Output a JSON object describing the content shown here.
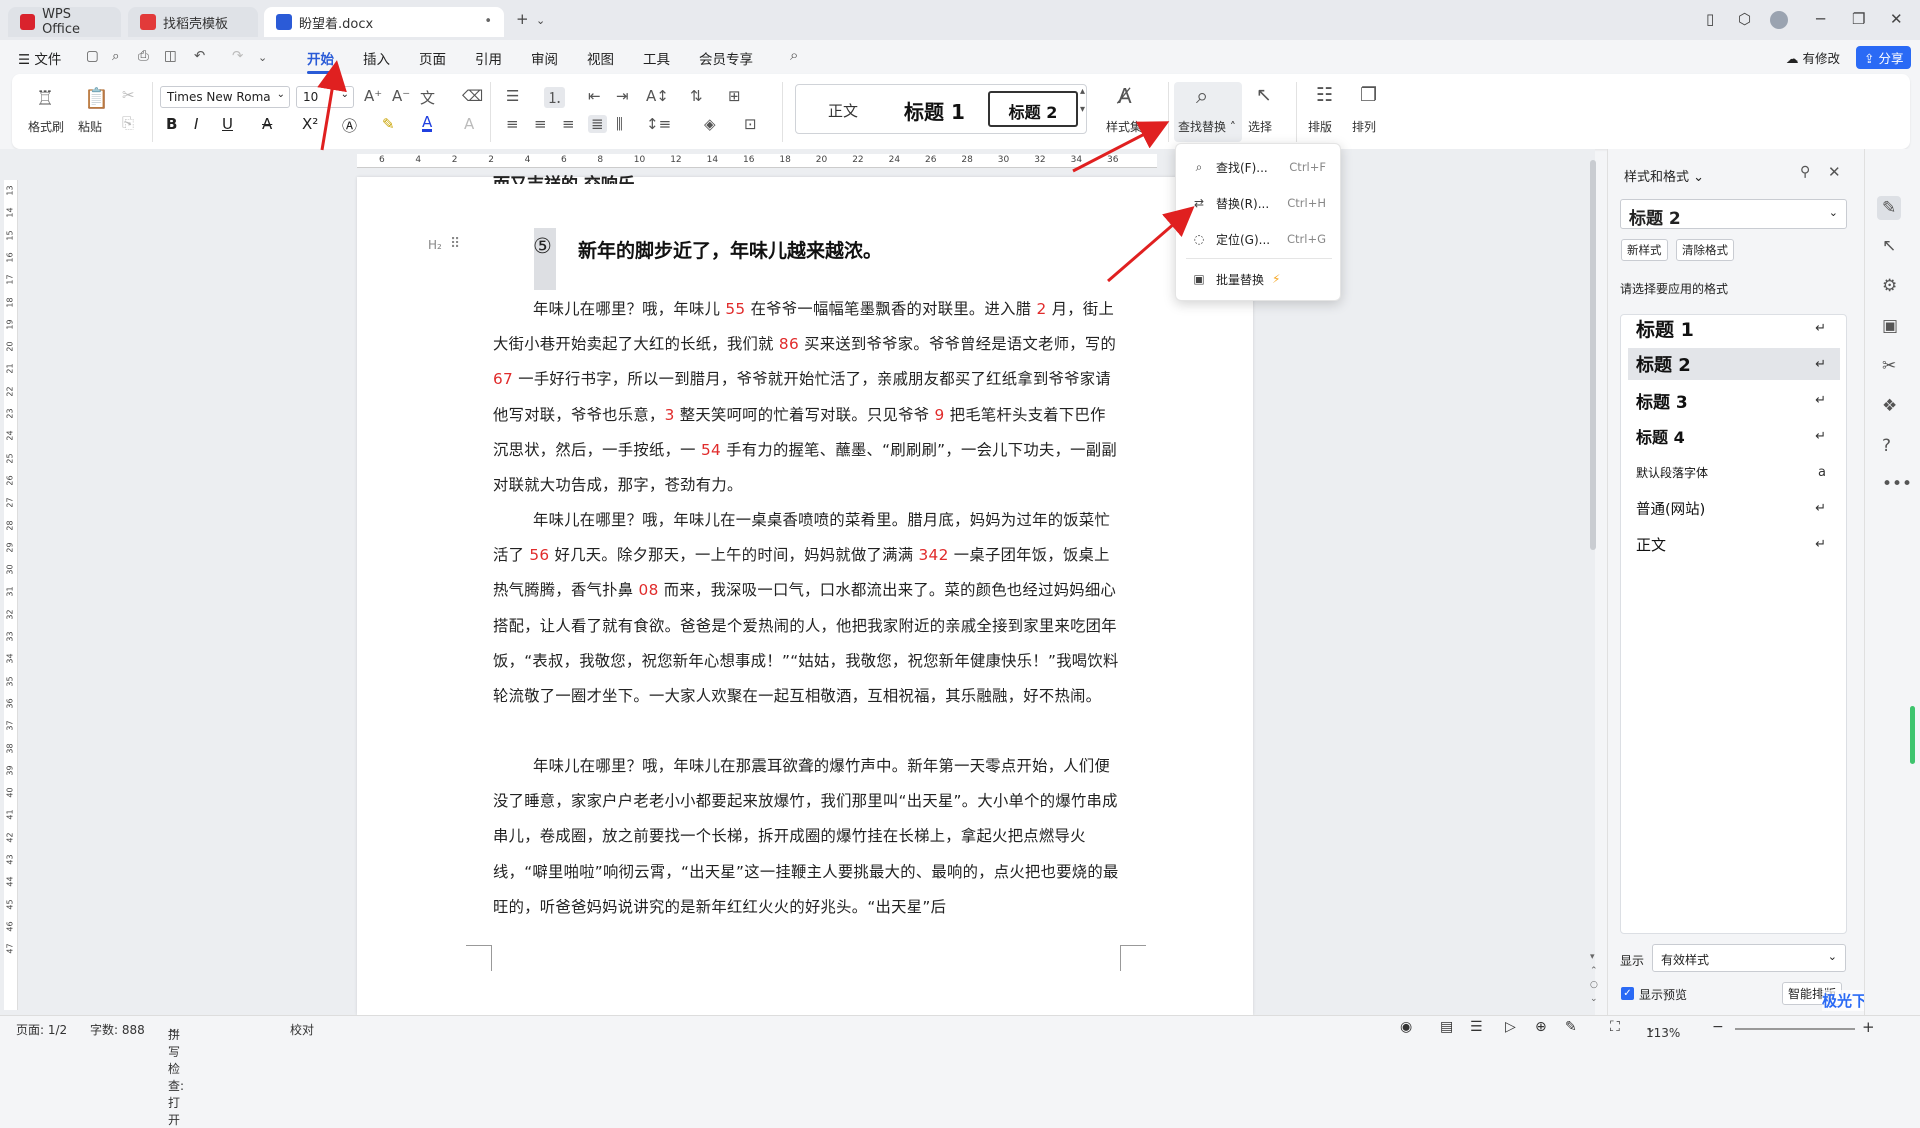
{
  "tabs": [
    {
      "label": "WPS Office",
      "color": "#d9232d"
    },
    {
      "label": "找稻壳模板",
      "color": "#e23a3a"
    },
    {
      "label": "盼望着.docx",
      "color": "#2b5bd7",
      "close": "•"
    }
  ],
  "menu": {
    "file": "文件",
    "items": [
      "开始",
      "插入",
      "页面",
      "引用",
      "审阅",
      "视图",
      "工具",
      "会员专享"
    ],
    "active": "开始",
    "modified": "有修改",
    "share": "分享"
  },
  "ribbon": {
    "format_brush": "格式刷",
    "paste": "粘贴",
    "font_name": "Times New Roma",
    "font_size": "10",
    "styles": {
      "normal": "正文",
      "h1": "标题 1",
      "h2": "标题 2"
    },
    "style_set": "样式集",
    "find_replace": "查找替换",
    "select": "选择",
    "layout": "排版",
    "arrange": "排列"
  },
  "ruler": {
    "h": [
      "6",
      "4",
      "2",
      "2",
      "4",
      "6",
      "8",
      "10",
      "12",
      "14",
      "16",
      "18",
      "20",
      "22",
      "24",
      "26",
      "28",
      "30",
      "32",
      "34",
      "36"
    ],
    "v": [
      "13",
      "14",
      "15",
      "16",
      "17",
      "18",
      "19",
      "20",
      "21",
      "22",
      "23",
      "24",
      "25",
      "26",
      "27",
      "28",
      "29",
      "30",
      "31",
      "32",
      "33",
      "34",
      "35",
      "36",
      "37",
      "38",
      "39",
      "40",
      "41",
      "42",
      "43",
      "44",
      "45",
      "46",
      "47"
    ]
  },
  "doc": {
    "cut_heading": "而又吉祥的 交响乐。",
    "heading_label": "H₂",
    "heading_num": "⑤",
    "heading": "新年的脚步近了，年味儿越来越浓。",
    "p1": [
      "年味儿在哪里？哦，年味儿 ",
      "55",
      " 在爷爷一幅幅笔墨飘香的对联里。进入腊 ",
      "2",
      " 月，街上大街小巷开始卖起了大红的长纸，我们就 ",
      "86",
      " 买来送到爷爷家。爷爷曾经是语文老师，写的 ",
      "67",
      " 一手好行书字，所以一到腊月，爷爷就开始忙活了，亲戚朋友都买了红纸拿到爷爷家请他写对联，爷爷也乐意，",
      "3",
      " 整天笑呵呵的忙着写对联。只见爷爷 ",
      "9",
      " 把毛笔杆头支着下巴作沉思状，然后，一手按纸，一 ",
      "54",
      " 手有力的握笔、蘸墨、“刷刷刷”，一会儿下功夫，一副副对联就大功告成，那字，苍劲有力。"
    ],
    "p2": [
      "年味儿在哪里？哦，年味儿在一桌桌香喷喷的菜肴里。腊月底，妈妈为过年的饭菜忙活了 ",
      "56",
      " 好几天。除夕那天，一上午的时间，妈妈就做了满满 ",
      "342",
      " 一桌子团年饭，饭桌上热气腾腾，香气扑鼻 ",
      "08",
      " 而来，我深吸一口气，口水都流出来了。菜的颜色也经过妈妈细心搭配，让人看了就有食欲。爸爸是个爱热闹的人，他把我家附近的亲戚全接到家里来吃团年饭，“表叔，我敬您，祝您新年心想事成！”“姑姑，我敬您，祝您新年健康快乐！”我喝饮料轮流敬了一圈才坐下。一大家人欢聚在一起互相敬酒，互相祝福，其乐融融，好不热闹。"
    ],
    "p3": "年味儿在哪里？哦，年味儿在那震耳欲聋的爆竹声中。新年第一天零点开始，人们便没了睡意，家家户户老老小小都要起来放爆竹，我们那里叫“出天星”。大小单个的爆竹串成串儿，卷成圈，放之前要找一个长梯，拆开成圈的爆竹挂在长梯上，拿起火把点燃导火线，“噼里啪啦”响彻云霄，“出天星”这一挂鞭主人要挑最大的、最响的，点火把也要烧的最旺的，听爸爸妈妈说讲究的是新年红红火火的好兆头。“出天星”后"
  },
  "find_menu": [
    {
      "label": "查找(F)...",
      "shortcut": "Ctrl+F",
      "icon": "search-icon"
    },
    {
      "label": "替换(R)...",
      "shortcut": "Ctrl+H",
      "icon": "replace-icon"
    },
    {
      "label": "定位(G)...",
      "shortcut": "Ctrl+G",
      "icon": "locate-icon"
    },
    {
      "label": "批量替换",
      "shortcut": "",
      "icon": "batch-replace-icon"
    }
  ],
  "panel": {
    "title": "样式和格式",
    "current": "标题 2",
    "new_style": "新样式",
    "clear_format": "清除格式",
    "prompt": "请选择要应用的格式",
    "styles": [
      {
        "label": "标题 1",
        "size": "19px",
        "bold": true
      },
      {
        "label": "标题 2",
        "size": "18px",
        "bold": true
      },
      {
        "label": "标题 3",
        "size": "17px",
        "bold": true
      },
      {
        "label": "标题 4",
        "size": "16px",
        "bold": true
      },
      {
        "label": "默认段落字体",
        "size": "12px",
        "bold": false
      },
      {
        "label": "普通(网站)",
        "size": "14.5px",
        "bold": false
      },
      {
        "label": "正文",
        "size": "15px",
        "bold": false
      }
    ],
    "show_label": "显示",
    "show_value": "有效样式",
    "preview": "显示预览",
    "smart": "智能排版"
  },
  "status": {
    "page": "页面: 1/2",
    "words": "字数: 888",
    "spell": "拼写检查: 打开",
    "proof": "校对",
    "zoom": "113%"
  },
  "watermark": "极光下载站"
}
